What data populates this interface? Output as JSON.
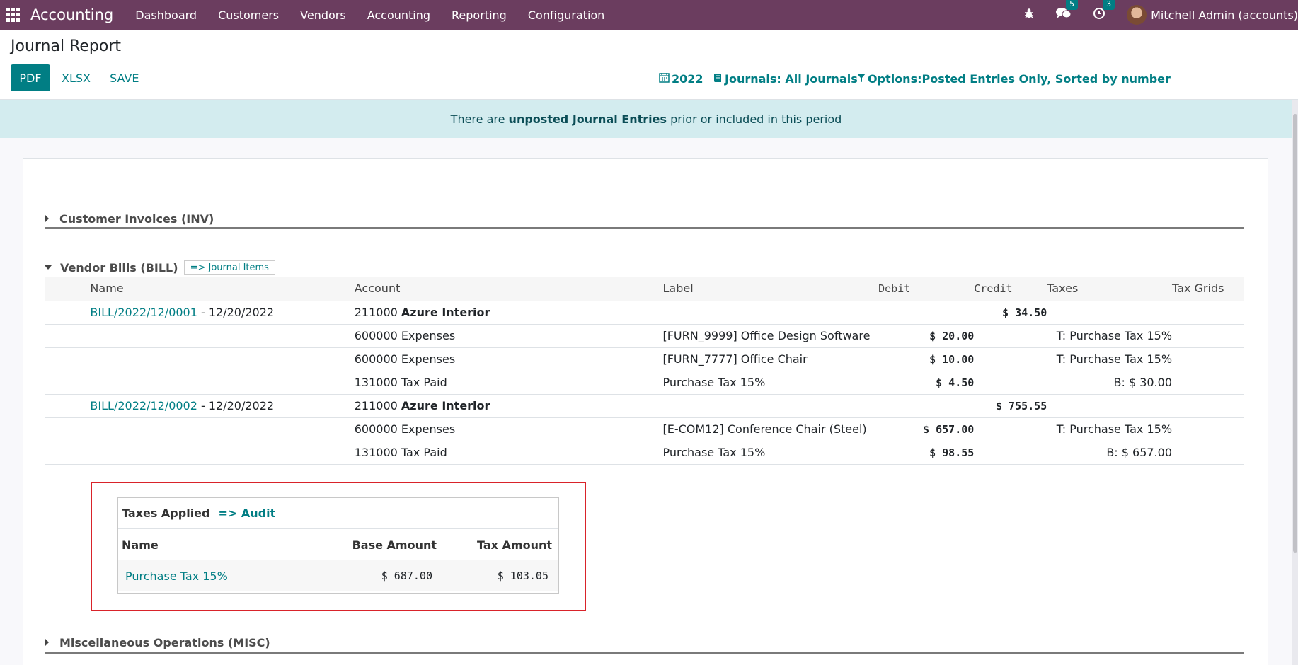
{
  "navbar": {
    "app_name": "Accounting",
    "menu": [
      "Dashboard",
      "Customers",
      "Vendors",
      "Accounting",
      "Reporting",
      "Configuration"
    ],
    "messages_count": "5",
    "activities_count": "3",
    "user": "Mitchell Admin (accounts)",
    "bar_color": "#6b3d5f"
  },
  "control_panel": {
    "title": "Journal Report",
    "pdf_label": "PDF",
    "xlsx_label": "XLSX",
    "save_label": "SAVE",
    "date_filter": "2022",
    "journals_filter": "Journals: All Journals",
    "options_filter": "Options:Posted Entries Only, Sorted by number",
    "accent_color": "#017e84"
  },
  "alert": {
    "prefix": "There are ",
    "link": "unposted Journal Entries",
    "suffix": " prior or included in this period"
  },
  "sections": {
    "inv": "Customer Invoices (INV)",
    "bill": "Vendor Bills (BILL)",
    "bill_items_link": "=> Journal Items",
    "misc": "Miscellaneous Operations (MISC)"
  },
  "table": {
    "headers": {
      "name": "Name",
      "account": "Account",
      "label": "Label",
      "debit": "Debit",
      "credit": "Credit",
      "taxes": "Taxes",
      "tax_grids": "Tax Grids"
    },
    "rows": [
      {
        "name": "BILL/2022/12/0001",
        "date": " - 12/20/2022",
        "account_code": "211000 ",
        "account_name": "Azure Interior",
        "account_bold": true,
        "label": "",
        "debit": "",
        "credit": "$ 34.50",
        "taxes": "",
        "tax_grids": ""
      },
      {
        "name": "",
        "date": "",
        "account_code": "600000 Expenses",
        "account_name": "",
        "account_bold": false,
        "label": "[FURN_9999] Office Design Software",
        "debit": "$ 20.00",
        "credit": "",
        "taxes": "T: Purchase Tax 15%",
        "tax_grids": ""
      },
      {
        "name": "",
        "date": "",
        "account_code": "600000 Expenses",
        "account_name": "",
        "account_bold": false,
        "label": "[FURN_7777] Office Chair",
        "debit": "$ 10.00",
        "credit": "",
        "taxes": "T: Purchase Tax 15%",
        "tax_grids": ""
      },
      {
        "name": "",
        "date": "",
        "account_code": "131000 Tax Paid",
        "account_name": "",
        "account_bold": false,
        "label": "Purchase Tax 15%",
        "debit": "$ 4.50",
        "credit": "",
        "taxes": "B: $ 30.00",
        "tax_grids": ""
      },
      {
        "name": "BILL/2022/12/0002",
        "date": " - 12/20/2022",
        "account_code": "211000 ",
        "account_name": "Azure Interior",
        "account_bold": true,
        "label": "",
        "debit": "",
        "credit": "$ 755.55",
        "taxes": "",
        "tax_grids": ""
      },
      {
        "name": "",
        "date": "",
        "account_code": "600000 Expenses",
        "account_name": "",
        "account_bold": false,
        "label": "[E-COM12] Conference Chair (Steel)",
        "debit": "$ 657.00",
        "credit": "",
        "taxes": "T: Purchase Tax 15%",
        "tax_grids": ""
      },
      {
        "name": "",
        "date": "",
        "account_code": "131000 Tax Paid",
        "account_name": "",
        "account_bold": false,
        "label": "Purchase Tax 15%",
        "debit": "$ 98.55",
        "credit": "",
        "taxes": "B: $ 657.00",
        "tax_grids": ""
      }
    ]
  },
  "taxes_applied": {
    "title": "Taxes Applied",
    "audit_link": "=> Audit",
    "col_name": "Name",
    "col_base": "Base Amount",
    "col_tax": "Tax Amount",
    "row_name": "Purchase Tax 15%",
    "row_base": "$ 687.00",
    "row_tax": "$ 103.05",
    "highlight_color": "#d9232a"
  }
}
